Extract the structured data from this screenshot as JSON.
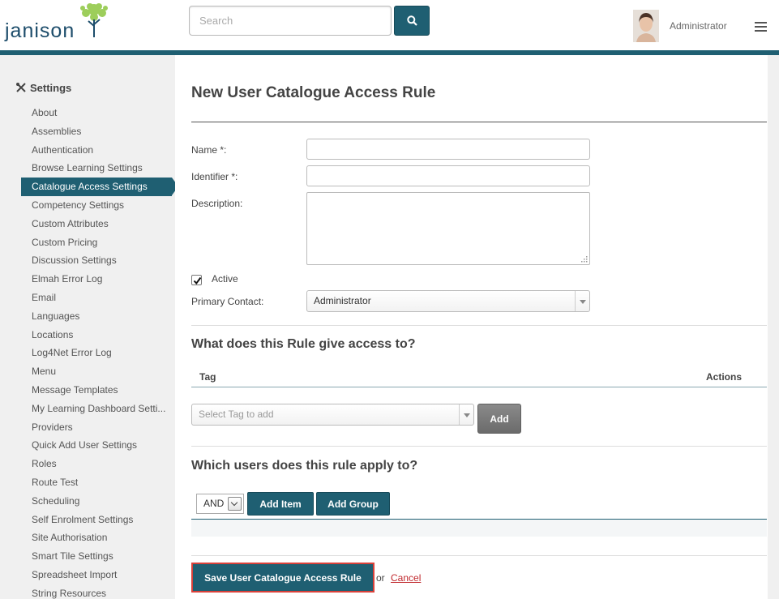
{
  "header": {
    "logo_text": "janison",
    "search_placeholder": "Search",
    "user_name": "Administrator"
  },
  "sidebar": {
    "title": "Settings",
    "items": [
      {
        "label": "About",
        "active": false
      },
      {
        "label": "Assemblies",
        "active": false
      },
      {
        "label": "Authentication",
        "active": false
      },
      {
        "label": "Browse Learning Settings",
        "active": false
      },
      {
        "label": "Catalogue Access Settings",
        "active": true
      },
      {
        "label": "Competency Settings",
        "active": false
      },
      {
        "label": "Custom Attributes",
        "active": false
      },
      {
        "label": "Custom Pricing",
        "active": false
      },
      {
        "label": "Discussion Settings",
        "active": false
      },
      {
        "label": "Elmah Error Log",
        "active": false
      },
      {
        "label": "Email",
        "active": false
      },
      {
        "label": "Languages",
        "active": false
      },
      {
        "label": "Locations",
        "active": false
      },
      {
        "label": "Log4Net Error Log",
        "active": false
      },
      {
        "label": "Menu",
        "active": false
      },
      {
        "label": "Message Templates",
        "active": false
      },
      {
        "label": "My Learning Dashboard Setti...",
        "active": false
      },
      {
        "label": "Providers",
        "active": false
      },
      {
        "label": "Quick Add User Settings",
        "active": false
      },
      {
        "label": "Roles",
        "active": false
      },
      {
        "label": "Route Test",
        "active": false
      },
      {
        "label": "Scheduling",
        "active": false
      },
      {
        "label": "Self Enrolment Settings",
        "active": false
      },
      {
        "label": "Site Authorisation",
        "active": false
      },
      {
        "label": "Smart Tile Settings",
        "active": false
      },
      {
        "label": "Spreadsheet Import",
        "active": false
      },
      {
        "label": "String Resources",
        "active": false
      }
    ]
  },
  "form": {
    "title": "New User Catalogue Access Rule",
    "name_label": "Name *:",
    "name_value": "",
    "identifier_label": "Identifier *:",
    "identifier_value": "",
    "description_label": "Description:",
    "description_value": "",
    "active_label": "Active",
    "active_checked": true,
    "primary_contact_label": "Primary Contact:",
    "primary_contact_value": "Administrator"
  },
  "access": {
    "heading": "What does this Rule give access to?",
    "col_tag": "Tag",
    "col_actions": "Actions",
    "tag_select_placeholder": "Select Tag to add",
    "add_label": "Add"
  },
  "users": {
    "heading": "Which users does this rule apply to?",
    "operator": "AND",
    "add_item_label": "Add Item",
    "add_group_label": "Add Group"
  },
  "footer": {
    "save_label": "Save User Catalogue Access Rule",
    "or_text": "or",
    "cancel_label": "Cancel"
  },
  "colors": {
    "accent": "#1f5f72",
    "danger_outline": "#d9413a",
    "cancel_link": "#c0282d"
  }
}
